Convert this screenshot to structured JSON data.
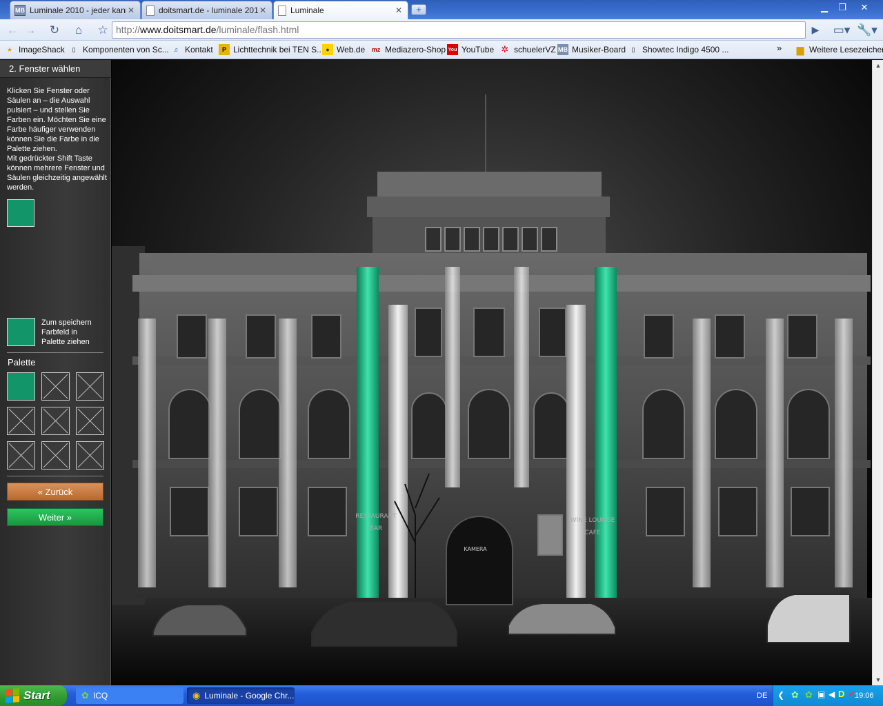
{
  "browser": {
    "tabs": [
      {
        "label": "Luminale 2010 - jeder kann...",
        "icon": "mb-favicon"
      },
      {
        "label": "doitsmart.de - luminale 201...",
        "icon": "page-icon"
      },
      {
        "label": "Luminale",
        "icon": "page-icon"
      }
    ],
    "url_prefix": "http://",
    "url_host": "www.doitsmart.de",
    "url_path": "/luminale/flash.html",
    "bookmarks": [
      {
        "label": "ImageShack"
      },
      {
        "label": "Komponenten von Sc..."
      },
      {
        "label": "Kontakt"
      },
      {
        "label": "Lichttechnik bei TEN S..."
      },
      {
        "label": "Web.de"
      },
      {
        "label": "Mediazero-Shop"
      },
      {
        "label": "YouTube"
      },
      {
        "label": "schuelerVZ"
      },
      {
        "label": "Musiker-Board"
      },
      {
        "label": "Showtec Indigo 4500 ..."
      }
    ],
    "bookmarks_more": "»",
    "other_bookmarks": "Weitere Lesezeichen"
  },
  "panel": {
    "title": "2. Fenster wählen",
    "instructions": "Klicken Sie Fenster oder Säulen an – die Auswahl pulsiert – und stellen Sie Farben ein. Möchten Sie eine Farbe häufiger verwenden können Sie die Farbe in die Palette ziehen.\nMit gedrückter Shift Taste können mehrere Fenster und Säulen gleichzeitig angewählt werden.",
    "current_color": "#13956a",
    "save_hint": "Zum speichern\nFarbfeld in\nPalette ziehen",
    "palette_title": "Palette",
    "palette_slots": [
      "#13956a",
      "empty",
      "empty",
      "empty",
      "empty",
      "empty",
      "empty",
      "empty",
      "empty"
    ],
    "back_label": "« Zurück",
    "next_label": "Weiter »"
  },
  "scene": {
    "sign_left_top": "RESTAURANT",
    "sign_left_bottom": "BAR",
    "sign_center": "KAMERA",
    "sign_right_top": "WINE LOUNGE",
    "sign_right_bottom": "CAFE",
    "highlight_color": "#18c98e"
  },
  "taskbar": {
    "start_label": "Start",
    "items": [
      {
        "label": "ICQ"
      },
      {
        "label": "Luminale - Google Chr..."
      }
    ],
    "language": "DE",
    "clock": "19:06"
  }
}
